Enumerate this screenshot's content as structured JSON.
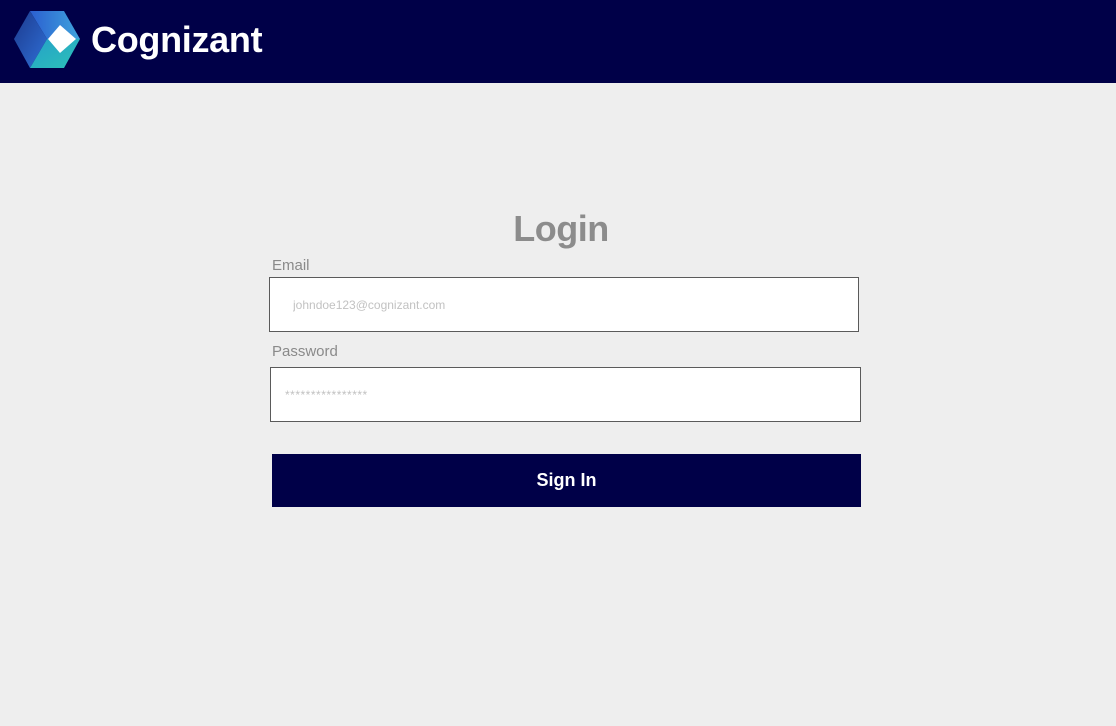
{
  "header": {
    "brand_name": "Cognizant",
    "logo_icon": "cognizant-logo-icon",
    "background_color": "#000048"
  },
  "login": {
    "title": "Login",
    "email": {
      "label": "Email",
      "placeholder": "johndoe123@cognizant.com",
      "value": ""
    },
    "password": {
      "label": "Password",
      "placeholder": "****************",
      "value": ""
    },
    "submit_label": "Sign In",
    "accent_color": "#000048"
  }
}
